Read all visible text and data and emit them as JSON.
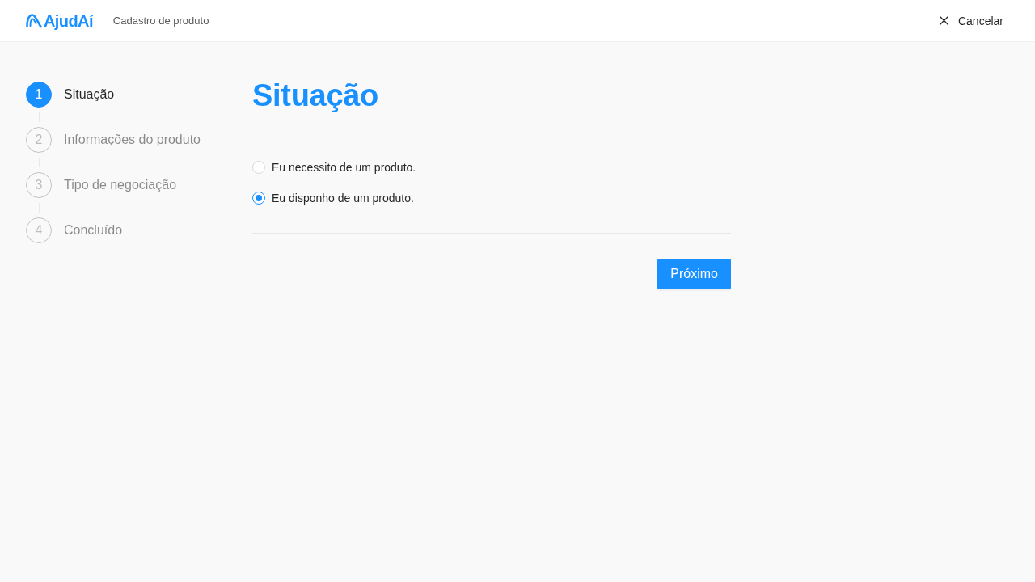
{
  "header": {
    "logo": "AjudAí",
    "page_title": "Cadastro de produto",
    "cancel_button": "Cancelar"
  },
  "steps": [
    {
      "number": "1",
      "label": "Situação",
      "selected": true
    },
    {
      "number": "2",
      "label": "Informações do produto",
      "selected": false
    },
    {
      "number": "3",
      "label": "Tipo de negociação",
      "selected": false
    },
    {
      "number": "4",
      "label": "Concluído",
      "selected": false
    }
  ],
  "form": {
    "title": "Situação",
    "options": [
      {
        "label": "Eu necessito de um produto.",
        "selected": false
      },
      {
        "label": "Eu disponho de um produto.",
        "selected": true
      }
    ],
    "next_button": "Próximo"
  }
}
